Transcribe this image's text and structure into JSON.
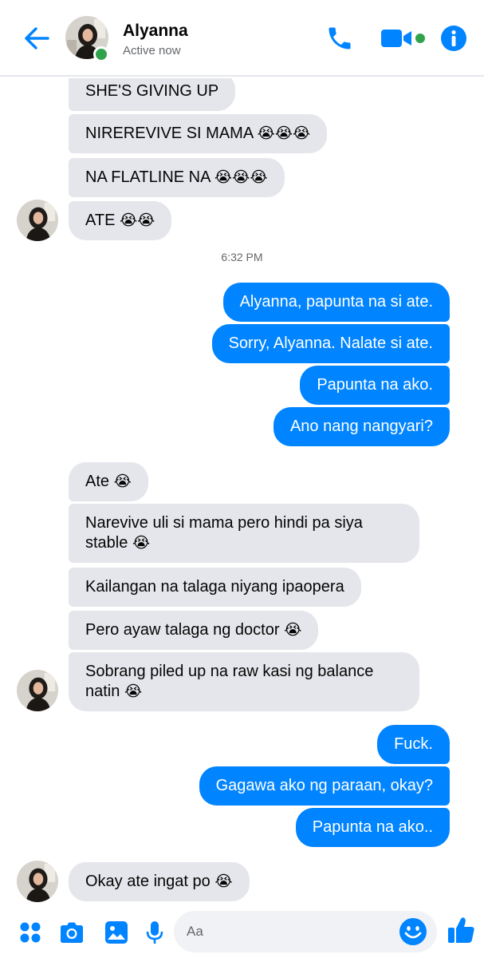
{
  "header": {
    "name": "Alyanna",
    "status": "Active now"
  },
  "icons": {
    "back": "arrow-left-icon",
    "phone": "phone-icon",
    "video": "video-camera-icon",
    "info": "info-icon",
    "menu": "four-dots-icon",
    "camera": "camera-icon",
    "gallery": "image-icon",
    "mic": "microphone-icon",
    "emoji": "smiley-icon",
    "like": "thumbs-up-icon"
  },
  "colors": {
    "accent": "#0084ff",
    "incoming_bubble": "#e4e6eb",
    "online": "#31a24c"
  },
  "timestamp": "6:32 PM",
  "messages": [
    {
      "text": "SHE'S GIVING UP",
      "emoji": ""
    },
    {
      "text": "NIREREVIVE SI MAMA",
      "emoji": "😭😭😭"
    },
    {
      "text": "NA FLATLINE NA",
      "emoji": "😭😭😭"
    },
    {
      "text": "ATE",
      "emoji": "😭😭"
    },
    {
      "text": "Alyanna, papunta na si ate.",
      "emoji": ""
    },
    {
      "text": "Sorry, Alyanna. Nalate si ate.",
      "emoji": ""
    },
    {
      "text": "Papunta na ako.",
      "emoji": ""
    },
    {
      "text": "Ano nang nangyari?",
      "emoji": ""
    },
    {
      "text": "Ate",
      "emoji": "😭"
    },
    {
      "text": "Narevive uli si mama pero hindi pa siya stable",
      "emoji": "😭"
    },
    {
      "text": "Kailangan na talaga niyang ipaopera",
      "emoji": ""
    },
    {
      "text": "Pero ayaw talaga ng doctor",
      "emoji": "😭"
    },
    {
      "text": "Sobrang piled up na raw kasi ng balance natin",
      "emoji": "😭"
    },
    {
      "text": "Fuck.",
      "emoji": ""
    },
    {
      "text": "Gagawa ako ng paraan, okay?",
      "emoji": ""
    },
    {
      "text": "Papunta na ako..",
      "emoji": ""
    },
    {
      "text": "Okay ate ingat po",
      "emoji": "😭"
    }
  ],
  "composer": {
    "placeholder": "Aa"
  }
}
